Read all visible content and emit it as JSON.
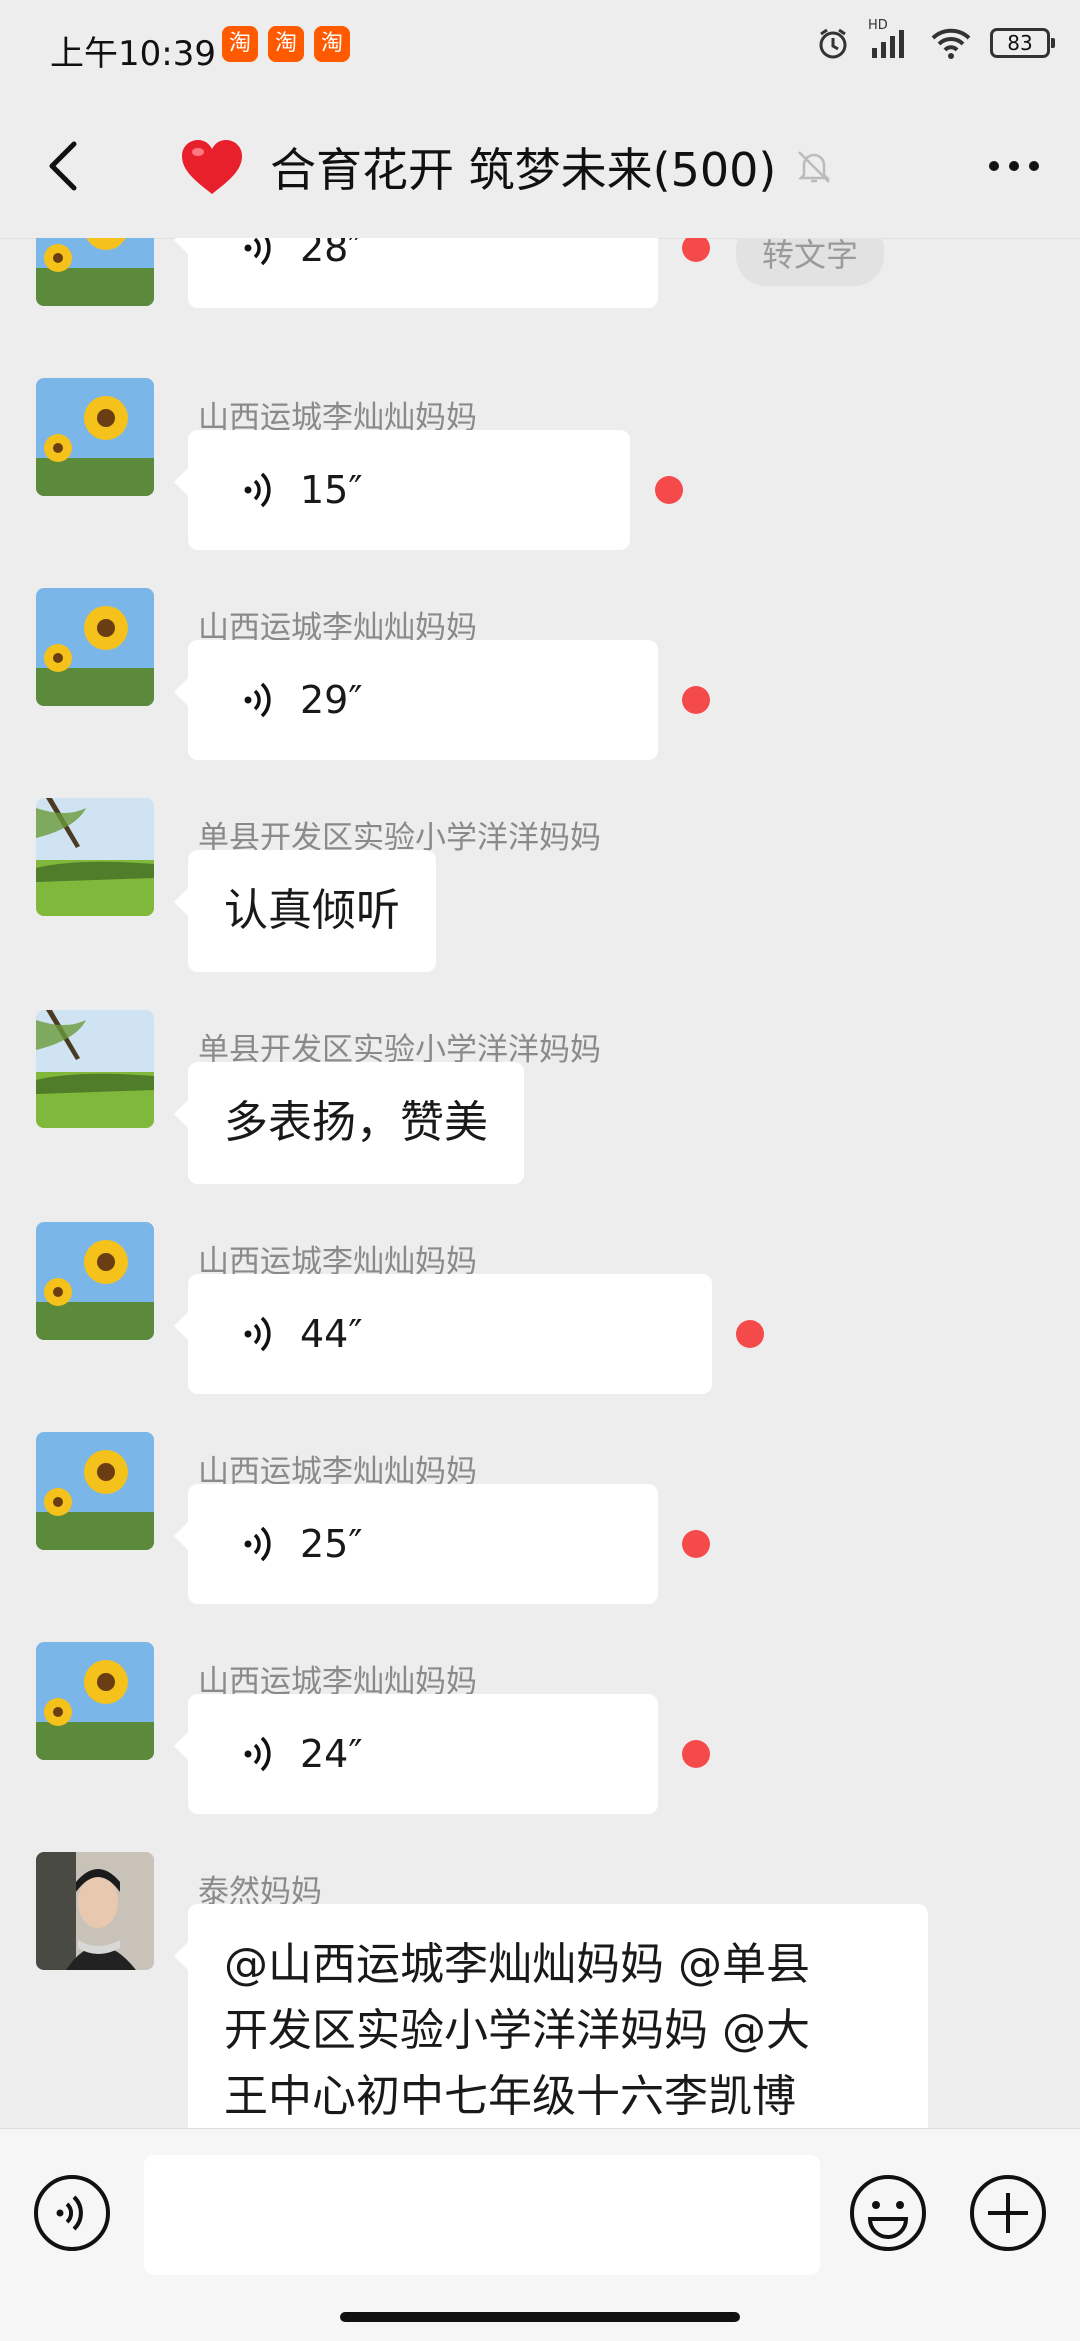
{
  "status_bar": {
    "time": "上午10:39",
    "app_icons": [
      "淘",
      "淘",
      "淘"
    ],
    "battery": "83",
    "network_label": "HD"
  },
  "header": {
    "title": "合育花开 筑梦未来(500)",
    "icons": [
      "back-icon",
      "heart-icon",
      "mute-bell-icon",
      "more-icon"
    ]
  },
  "messages": [
    {
      "sender": "",
      "type": "voice",
      "duration": "28″",
      "unread": true,
      "action": "转文字"
    },
    {
      "sender": "山西运城李灿灿妈妈",
      "type": "voice",
      "duration": "15″",
      "unread": true
    },
    {
      "sender": "山西运城李灿灿妈妈",
      "type": "voice",
      "duration": "29″",
      "unread": true
    },
    {
      "sender": "单县开发区实验小学洋洋妈妈",
      "type": "text",
      "text": "认真倾听"
    },
    {
      "sender": "单县开发区实验小学洋洋妈妈",
      "type": "text",
      "text": "多表扬，赞美"
    },
    {
      "sender": "山西运城李灿灿妈妈",
      "type": "voice",
      "duration": "44″",
      "unread": true
    },
    {
      "sender": "山西运城李灿灿妈妈",
      "type": "voice",
      "duration": "25″",
      "unread": true
    },
    {
      "sender": "山西运城李灿灿妈妈",
      "type": "voice",
      "duration": "24″",
      "unread": true
    },
    {
      "sender": "泰然妈妈",
      "type": "text",
      "text_lines": [
        "@山西运城李灿灿妈妈 @单县",
        "开发区实验小学洋洋妈妈 @大",
        "王中心初中七年级十六李凯博"
      ]
    }
  ],
  "input_bar": {
    "icons": [
      "voice-input-icon",
      "emoji-icon",
      "plus-icon"
    ],
    "input_value": ""
  },
  "colors": {
    "background": "#ededed",
    "bubble": "#ffffff",
    "unread_dot": "#f54a4a",
    "sender_name": "#8a8a8a"
  }
}
